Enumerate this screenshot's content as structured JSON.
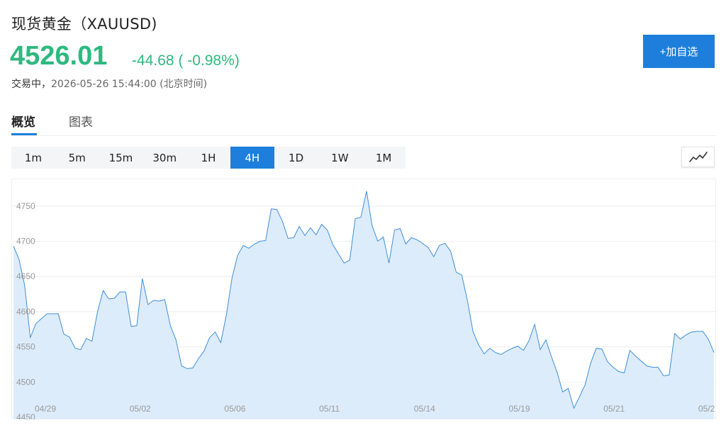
{
  "header": {
    "title": "现货黄金（XAUUSD)",
    "price": "4526.01",
    "change": "-44.68 ( -0.98%)",
    "status_label": "交易中，",
    "timestamp": "2026-05-26 15:44:00 (北京时间)",
    "add_button_label": "+加自选"
  },
  "tabs": [
    {
      "label": "概览",
      "active": true
    },
    {
      "label": "图表",
      "active": false
    }
  ],
  "periods": [
    {
      "label": "1m",
      "active": false
    },
    {
      "label": "5m",
      "active": false
    },
    {
      "label": "15m",
      "active": false
    },
    {
      "label": "30m",
      "active": false
    },
    {
      "label": "1H",
      "active": false
    },
    {
      "label": "4H",
      "active": true
    },
    {
      "label": "1D",
      "active": false
    },
    {
      "label": "1W",
      "active": false
    },
    {
      "label": "1M",
      "active": false
    }
  ],
  "colors": {
    "up_down_green": "#2db97f",
    "accent_blue": "#1d7fdb",
    "line": "#3e8fdb",
    "fill": "#ddecfb"
  },
  "chart_type_icon": "line-chart-icon",
  "chart_data": {
    "type": "area",
    "title": "",
    "xlabel": "",
    "ylabel": "",
    "ylim": [
      4446,
      4788
    ],
    "y_ticks": [
      4450,
      4500,
      4550,
      4600,
      4650,
      4700,
      4750
    ],
    "x_ticks": [
      "04/29",
      "05/02",
      "05/06",
      "05/11",
      "05/14",
      "05/19",
      "05/21",
      "05/2"
    ],
    "grid": true,
    "values": [
      4693,
      4674,
      4637,
      4563,
      4583,
      4590,
      4597,
      4597,
      4597,
      4568,
      4564,
      4548,
      4546,
      4562,
      4558,
      4600,
      4630,
      4618,
      4619,
      4628,
      4628,
      4579,
      4580,
      4647,
      4610,
      4616,
      4615,
      4617,
      4580,
      4560,
      4523,
      4519,
      4520,
      4533,
      4544,
      4563,
      4571,
      4556,
      4596,
      4648,
      4680,
      4694,
      4690,
      4696,
      4700,
      4701,
      4746,
      4745,
      4728,
      4704,
      4705,
      4721,
      4708,
      4719,
      4709,
      4724,
      4716,
      4695,
      4682,
      4669,
      4673,
      4732,
      4734,
      4771,
      4722,
      4700,
      4706,
      4669,
      4716,
      4718,
      4696,
      4705,
      4702,
      4697,
      4691,
      4678,
      4694,
      4697,
      4686,
      4656,
      4652,
      4616,
      4572,
      4553,
      4540,
      4548,
      4542,
      4539,
      4544,
      4548,
      4551,
      4545,
      4559,
      4582,
      4546,
      4560,
      4536,
      4514,
      4486,
      4491,
      4463,
      4479,
      4496,
      4527,
      4548,
      4547,
      4529,
      4521,
      4515,
      4513,
      4545,
      4537,
      4530,
      4523,
      4521,
      4521,
      4509,
      4510,
      4569,
      4561,
      4567,
      4571,
      4572,
      4572,
      4561,
      4542
    ]
  }
}
